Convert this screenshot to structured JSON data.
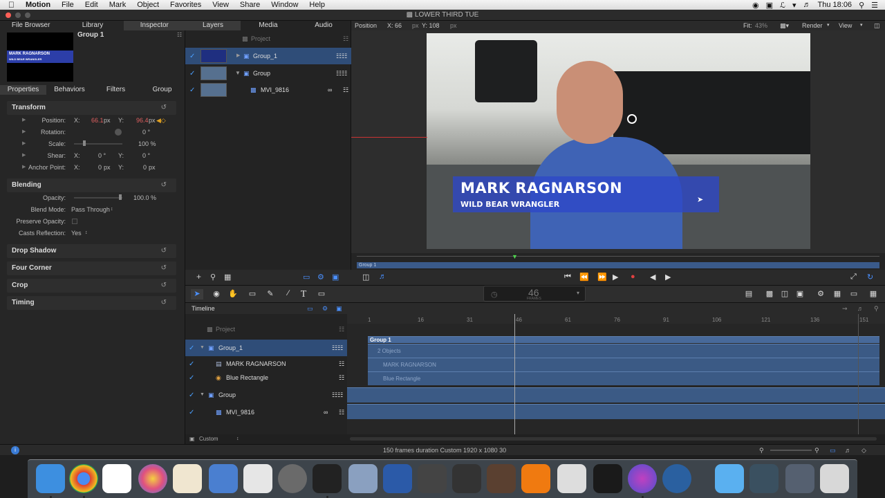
{
  "menubar": {
    "apple": "",
    "app": "Motion",
    "items": [
      "File",
      "Edit",
      "Mark",
      "Object",
      "Favorites",
      "View",
      "Share",
      "Window",
      "Help"
    ],
    "clock": "Thu 18:06"
  },
  "window": {
    "title": "LOWER THIRD TUE"
  },
  "inspector": {
    "top_tabs": [
      "File Browser",
      "Library",
      "Inspector"
    ],
    "preview_title": "Group 1",
    "preview_line1": "MARK RAGNARSON",
    "preview_line2": "WILD BEAR WRANGLER",
    "sub_tabs": [
      "Properties",
      "Behaviors",
      "Filters",
      "Group"
    ],
    "transform": {
      "title": "Transform",
      "position_label": "Position:",
      "position_x": "66.1",
      "position_y": "96.4",
      "rotation_label": "Rotation:",
      "rotation_val": "0 °",
      "scale_label": "Scale:",
      "scale_val": "100 %",
      "shear_label": "Shear:",
      "shear_x": "0 °",
      "shear_y": "0 °",
      "anchor_label": "Anchor Point:",
      "anchor_x": "0",
      "anchor_y": "0",
      "x": "X:",
      "y": "Y:",
      "px": "px"
    },
    "blending": {
      "title": "Blending",
      "opacity_label": "Opacity:",
      "opacity_val": "100.0 %",
      "blend_label": "Blend Mode:",
      "blend_val": "Pass Through",
      "preserve_label": "Preserve Opacity:",
      "casts_label": "Casts Reflection:",
      "casts_val": "Yes"
    },
    "sections": [
      "Drop Shadow",
      "Four Corner",
      "Crop",
      "Timing"
    ]
  },
  "layers": {
    "tabs": [
      "Layers",
      "Media",
      "Audio"
    ],
    "project": "Project",
    "rows": [
      {
        "label": "Group_1"
      },
      {
        "label": "Group"
      },
      {
        "label": "MVI_9816"
      }
    ]
  },
  "canvas": {
    "position_label": "Position",
    "pos_x": "X: 66",
    "pos_y": "Y: 108",
    "px": "px",
    "fit_label": "Fit:",
    "fit_val": "43%",
    "render": "Render",
    "view": "View",
    "lower_third_name": "MARK RAGNARSON",
    "lower_third_sub": "WILD BEAR WRANGLER",
    "mini_timeline_label": "Group 1"
  },
  "toolbar": {
    "frame_number": "46",
    "frame_unit": "FRAMES"
  },
  "timeline": {
    "title": "Timeline",
    "project": "Project",
    "rows": [
      {
        "label": "Group_1"
      },
      {
        "label": "MARK RAGNARSON"
      },
      {
        "label": "Blue Rectangle"
      },
      {
        "label": "Group"
      },
      {
        "label": "MVI_9816"
      }
    ],
    "ruler": [
      "1",
      "16",
      "31",
      "46",
      "61",
      "76",
      "91",
      "106",
      "121",
      "136",
      "151"
    ],
    "bar_group": "Group 1",
    "bar_objects": "2 Objects",
    "bar_name": "MARK RAGNARSON",
    "bar_rect": "Blue Rectangle",
    "footer_left": "Custom"
  },
  "status": {
    "text": "150 frames duration Custom 1920 x 1080 30"
  },
  "colors": {
    "accent": "#3a6fd8",
    "lower_third": "#2d46c8",
    "selection": "#2f4d78",
    "bar": "#3b5a85"
  }
}
